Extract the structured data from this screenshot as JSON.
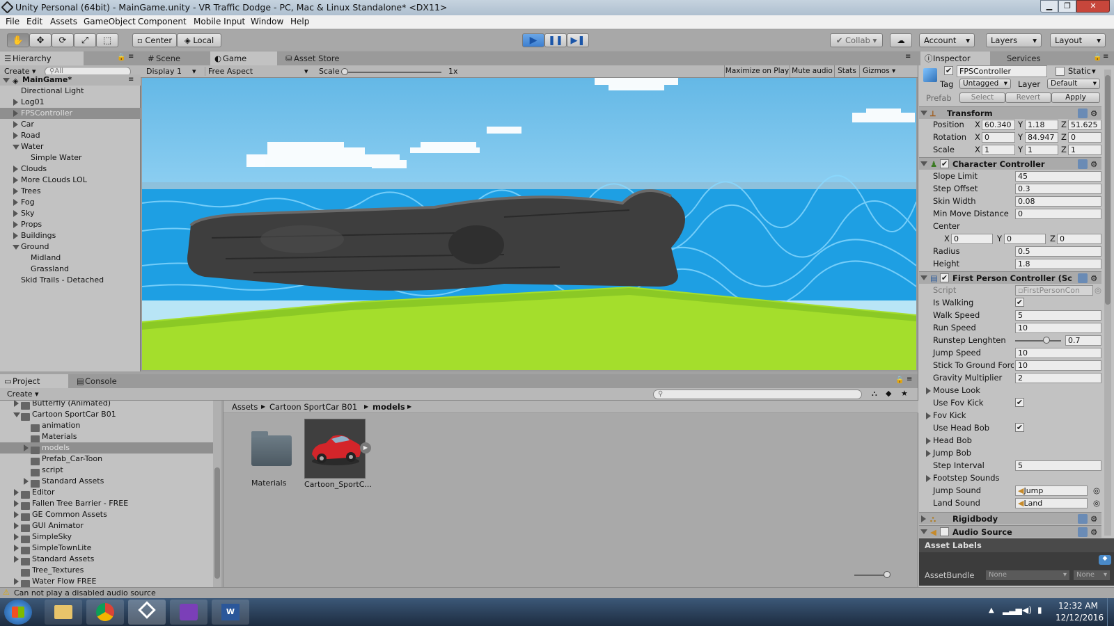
{
  "window": {
    "title": "Unity Personal (64bit) - MainGame.unity - VR Traffic Dodge - PC, Mac & Linux Standalone* <DX11>"
  },
  "menu": [
    "File",
    "Edit",
    "Assets",
    "GameObject",
    "Component",
    "Mobile Input",
    "Window",
    "Help"
  ],
  "toolbar": {
    "center": "Center",
    "local": "Local",
    "collab": "Collab",
    "account": "Account",
    "layers": "Layers",
    "layout": "Layout"
  },
  "hierarchy": {
    "tab": "Hierarchy",
    "create": "Create",
    "search": "All",
    "scene": "MainGame*",
    "items": [
      "Directional Light",
      "Log01",
      "FPSController",
      "Car",
      "Road",
      "Water",
      "Simple Water",
      "Clouds",
      "More CLouds LOL",
      "Trees",
      "Fog",
      "Sky",
      "Props",
      "Buildings",
      "Ground",
      "Midland",
      "Grassland",
      "Skid Trails - Detached"
    ]
  },
  "tabs": {
    "scene": "Scene",
    "game": "Game",
    "asset_store": "Asset Store"
  },
  "game_bar": {
    "display": "Display 1",
    "aspect": "Free Aspect",
    "scale": "Scale",
    "scale_value": "1x",
    "maximize": "Maximize on Play",
    "mute": "Mute audio",
    "stats": "Stats",
    "gizmos": "Gizmos"
  },
  "inspector": {
    "tab": "Inspector",
    "services": "Services",
    "object_name": "FPSController",
    "static": "Static",
    "tag_label": "Tag",
    "tag": "Untagged",
    "layer_label": "Layer",
    "layer": "Default",
    "prefab": "Prefab",
    "select": "Select",
    "revert": "Revert",
    "apply": "Apply",
    "transform": {
      "title": "Transform",
      "position": "Position",
      "rotation": "Rotation",
      "scale": "Scale",
      "pos": [
        "60.340",
        "1.18",
        "51.625"
      ],
      "rot": [
        "0",
        "84.947",
        "0"
      ],
      "scl": [
        "1",
        "1",
        "1"
      ]
    },
    "cc": {
      "title": "Character Controller",
      "slope_limit": "Slope Limit",
      "slope_limit_v": "45",
      "step_offset": "Step Offset",
      "step_offset_v": "0.3",
      "skin_width": "Skin Width",
      "skin_width_v": "0.08",
      "min_move": "Min Move Distance",
      "min_move_v": "0",
      "center": "Center",
      "center_v": [
        "0",
        "0",
        "0"
      ],
      "radius": "Radius",
      "radius_v": "0.5",
      "height": "Height",
      "height_v": "1.8"
    },
    "fpc": {
      "title": "First Person Controller (Sc",
      "script": "Script",
      "script_v": "FirstPersonCon",
      "is_walking": "Is Walking",
      "walk_speed": "Walk Speed",
      "walk_speed_v": "5",
      "run_speed": "Run Speed",
      "run_speed_v": "10",
      "runstep": "Runstep Lenghten",
      "runstep_v": "0.7",
      "jump_speed": "Jump Speed",
      "jump_speed_v": "10",
      "stick": "Stick To Ground Forc",
      "stick_v": "10",
      "gravity": "Gravity Multiplier",
      "gravity_v": "2",
      "mouse_look": "Mouse Look",
      "use_fov": "Use Fov Kick",
      "fov_kick": "Fov Kick",
      "use_head_bob": "Use Head Bob",
      "head_bob": "Head Bob",
      "jump_bob": "Jump Bob",
      "step_interval": "Step Interval",
      "step_interval_v": "5",
      "footstep": "Footstep Sounds",
      "jump_sound": "Jump Sound",
      "jump_sound_v": "Jump",
      "land_sound": "Land Sound",
      "land_sound_v": "Land"
    },
    "rigidbody": "Rigidbody",
    "audio_source": "Audio Source",
    "asset_labels": "Asset Labels",
    "asset_bundle": "AssetBundle",
    "none": "None"
  },
  "project": {
    "tab": "Project",
    "console": "Console",
    "create": "Create",
    "tree": [
      "Butterfly (Animated)",
      "Cartoon SportCar B01",
      "animation",
      "Materials",
      "models",
      "Prefab_Car-Toon",
      "script",
      "Standard Assets",
      "Editor",
      "Fallen Tree Barrier - FREE",
      "GE Common Assets",
      "GUI Animator",
      "SimpleSky",
      "SimpleTownLite",
      "Standard Assets",
      "Tree_Textures",
      "Water Flow FREE"
    ],
    "breadcrumb": [
      "Assets",
      "Cartoon SportCar B01",
      "models"
    ],
    "files": [
      "Materials",
      "Cartoon_SportC..."
    ]
  },
  "status": "Can not play a disabled audio source",
  "taskbar": {
    "time": "12:32 AM",
    "date": "12/12/2016"
  },
  "colors": {
    "accent": "#3d8fd9",
    "selected_row": "#8f8f8f",
    "sky": "#67bce6",
    "water": "#1ea7e8",
    "grass": "#a6e02c"
  }
}
